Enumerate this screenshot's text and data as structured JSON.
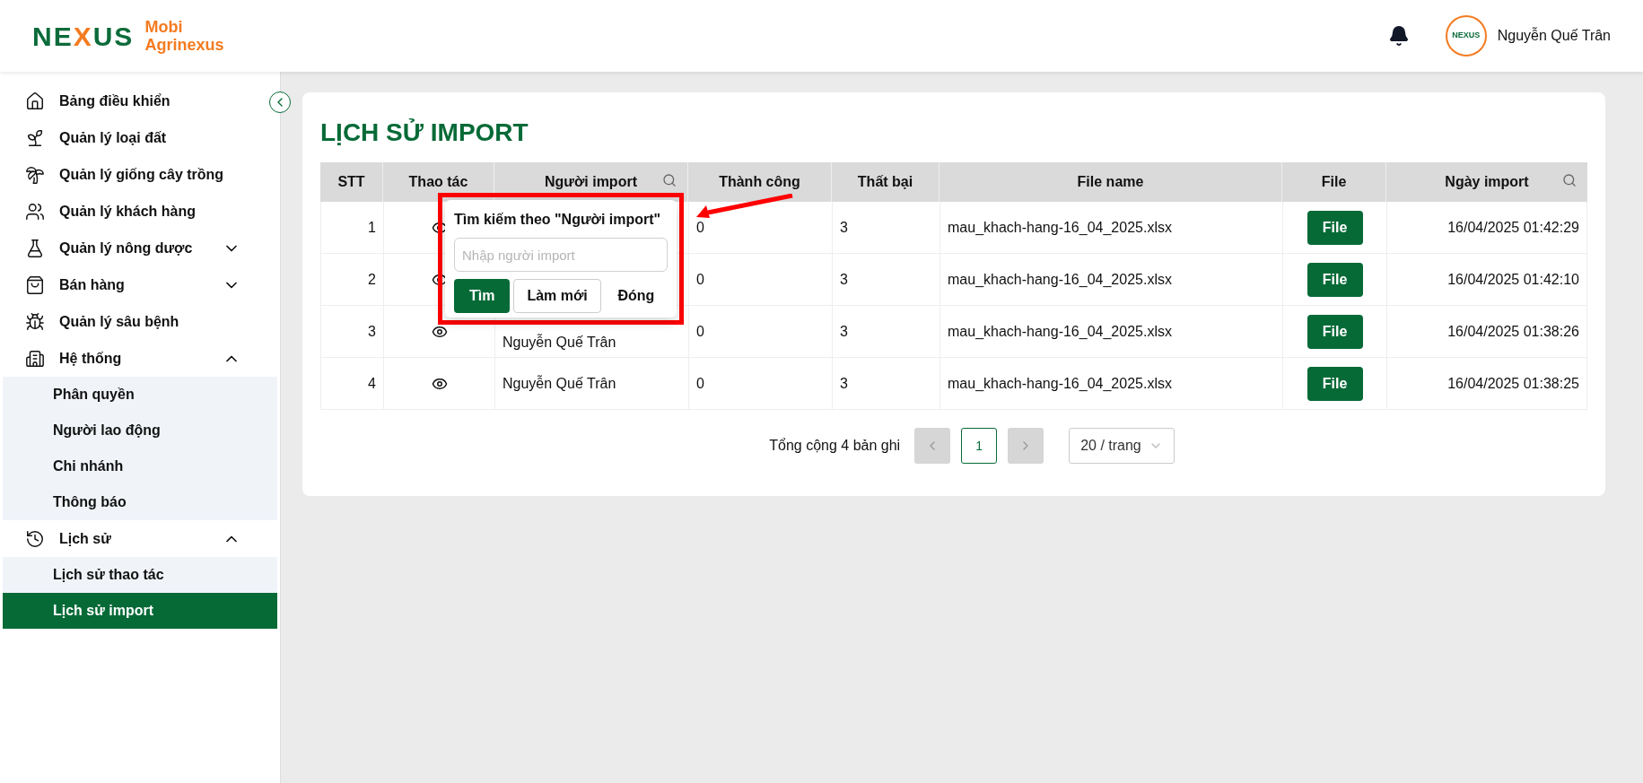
{
  "logo": {
    "mark_left": "NE",
    "mark_x": "X",
    "mark_right": "US",
    "line1": "Mobi",
    "line2": "Agrinexus"
  },
  "header": {
    "avatar_text": "NEXUS",
    "user_name": "Nguyễn Quế Trân"
  },
  "sidebar": {
    "items": [
      {
        "label": "Bảng điều khiển",
        "expanded": false,
        "has_children": false,
        "selected": false
      },
      {
        "label": "Quản lý loại đất",
        "expanded": false,
        "has_children": false,
        "selected": false
      },
      {
        "label": "Quản lý giống cây trồng",
        "expanded": false,
        "has_children": false,
        "selected": false
      },
      {
        "label": "Quản lý khách hàng",
        "expanded": false,
        "has_children": false,
        "selected": false
      },
      {
        "label": "Quản lý nông dược",
        "expanded": false,
        "has_children": true,
        "selected": false
      },
      {
        "label": "Bán hàng",
        "expanded": false,
        "has_children": true,
        "selected": false
      },
      {
        "label": "Quản lý sâu bệnh",
        "expanded": false,
        "has_children": false,
        "selected": false
      },
      {
        "label": "Hệ thống",
        "expanded": true,
        "has_children": true,
        "selected": false,
        "children": [
          {
            "label": "Phân quyền",
            "selected": false
          },
          {
            "label": "Người lao động",
            "selected": false
          },
          {
            "label": "Chi nhánh",
            "selected": false
          },
          {
            "label": "Thông báo",
            "selected": false
          }
        ]
      },
      {
        "label": "Lịch sử",
        "expanded": true,
        "has_children": true,
        "selected": false,
        "children": [
          {
            "label": "Lịch sử thao tác",
            "selected": false
          },
          {
            "label": "Lịch sử import",
            "selected": true
          }
        ]
      }
    ]
  },
  "page": {
    "title": "LỊCH SỬ IMPORT"
  },
  "table": {
    "columns": [
      {
        "label": "STT",
        "filterable": false
      },
      {
        "label": "Thao tác",
        "filterable": false
      },
      {
        "label": "Người import",
        "filterable": true
      },
      {
        "label": "Thành công",
        "filterable": false
      },
      {
        "label": "Thất bại",
        "filterable": false
      },
      {
        "label": "File name",
        "filterable": false
      },
      {
        "label": "File",
        "filterable": false
      },
      {
        "label": "Ngày import",
        "filterable": true
      }
    ],
    "rows": [
      {
        "stt": "1",
        "success": "0",
        "failed": "3",
        "file_name": "mau_khach-hang-16_04_2025.xlsx",
        "file_button": "File",
        "date": "16/04/2025 01:42:29"
      },
      {
        "stt": "2",
        "success": "0",
        "failed": "3",
        "file_name": "mau_khach-hang-16_04_2025.xlsx",
        "file_button": "File",
        "date": "16/04/2025 01:42:10"
      },
      {
        "stt": "3",
        "importer": "Nguyễn Quế Trân",
        "success": "0",
        "failed": "3",
        "file_name": "mau_khach-hang-16_04_2025.xlsx",
        "file_button": "File",
        "date": "16/04/2025 01:38:26"
      },
      {
        "stt": "4",
        "importer": "Nguyễn Quế Trân",
        "success": "0",
        "failed": "3",
        "file_name": "mau_khach-hang-16_04_2025.xlsx",
        "file_button": "File",
        "date": "16/04/2025 01:38:25"
      }
    ]
  },
  "pagination": {
    "total": "Tổng cộng 4 bản ghi",
    "pages": [
      {
        "label": "1",
        "selected": true
      }
    ],
    "page_size": "20 / trang"
  },
  "filter_popup": {
    "title": "Tìm kiếm theo \"Người import\"",
    "placeholder": "Nhập người import",
    "search_button": "Tìm",
    "reset_button": "Làm mới",
    "close_button": "Đóng"
  }
}
